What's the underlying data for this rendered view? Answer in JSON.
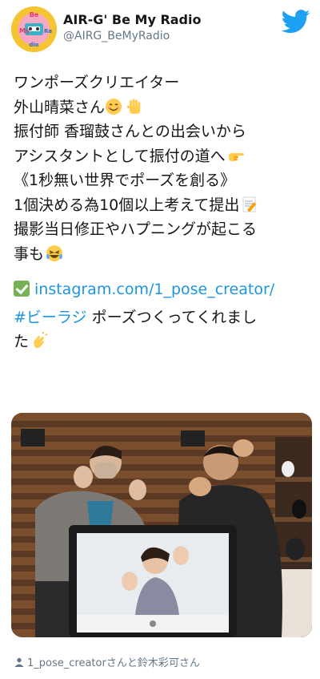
{
  "account": {
    "name": "AIR-G' Be My Radio",
    "handle": "@AIRG_BeMyRadio",
    "avatar_text": "Be My Radio"
  },
  "tweet": {
    "line1": "ワンポーズクリエイター",
    "line2": "外山晴菜さん",
    "line3": "振付師 香瑠鼓さんとの出会いから",
    "line4": "アシスタントとして振付の道へ",
    "line5": "《1秒無い世界でポーズを創る》",
    "line6": "1個決める為10個以上考えて提出",
    "line7": "撮影当日修正やハプニングが起こる",
    "line8": "事も",
    "link_text": "instagram.com/1_pose_creator/",
    "hashtag": "#ビーラジ",
    "line10": " ポーズつくってくれまし",
    "line11": "た"
  },
  "icons": {
    "brand": "twitter-bird-icon",
    "emoji1": "smiling-face-icon",
    "emoji2": "raised-hand-icon",
    "emoji3": "pointing-right-icon",
    "emoji4": "memo-icon",
    "emoji5": "rolling-laughing-icon",
    "emoji6": "clapping-hands-icon",
    "check": "check-mark-icon",
    "tag": "person-icon"
  },
  "photo": {
    "alt": "photo"
  },
  "tagged": {
    "user": "1_pose_creator",
    "rest": "さんと鈴木彩可さん"
  },
  "colors": {
    "link": "#1b95e0",
    "twitter_blue": "#1da1f2",
    "secondary_text": "#657786"
  }
}
